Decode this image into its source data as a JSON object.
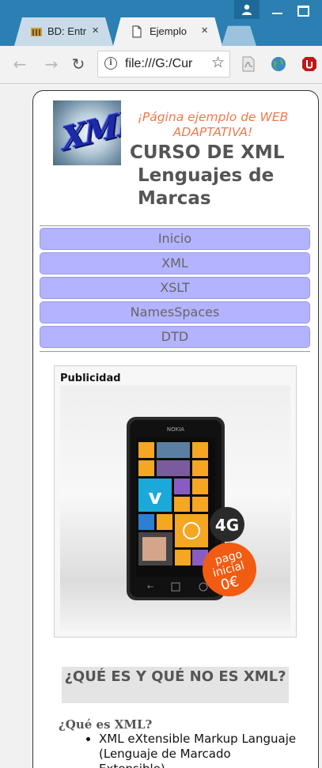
{
  "browser": {
    "tabs": [
      {
        "label": "BD: Entr",
        "close": "×"
      },
      {
        "label": "Ejemplo",
        "close": "×"
      }
    ],
    "url": "file:///G:/Cur",
    "nav_back": "←",
    "nav_forward": "→",
    "nav_reload": "↻",
    "info_icon": "i",
    "bookmark": "☆"
  },
  "header": {
    "logo_text": "XML",
    "tagline": "¡Página ejemplo de WEB ADAPTATIVA!",
    "title_line1": "CURSO DE XML",
    "title_line2": "Lenguajes de",
    "title_line3": "Marcas"
  },
  "nav": {
    "items": [
      {
        "label": "Inicio"
      },
      {
        "label": "XML"
      },
      {
        "label": "XSLT"
      },
      {
        "label": "NamesSpaces"
      },
      {
        "label": "DTD"
      }
    ]
  },
  "ad": {
    "label": "Publicidad",
    "phone_brand": "NOKIA",
    "badge_4g": "4G",
    "promo_line1": "pago",
    "promo_line2": "inicial",
    "promo_price": "0€"
  },
  "content": {
    "section_title": "¿QUÉ ES Y QUÉ NO ES XML?",
    "question": "¿Qué es XML?",
    "bullets": [
      "XML eXtensible Markup Languaje (Lenguaje de Marcado Extensible)"
    ]
  },
  "colors": {
    "titlebar": "#2b7fb3",
    "tagline": "#ee7a4c",
    "nav_item_bg": "#b3b3ff",
    "promo": "#f25b12"
  }
}
